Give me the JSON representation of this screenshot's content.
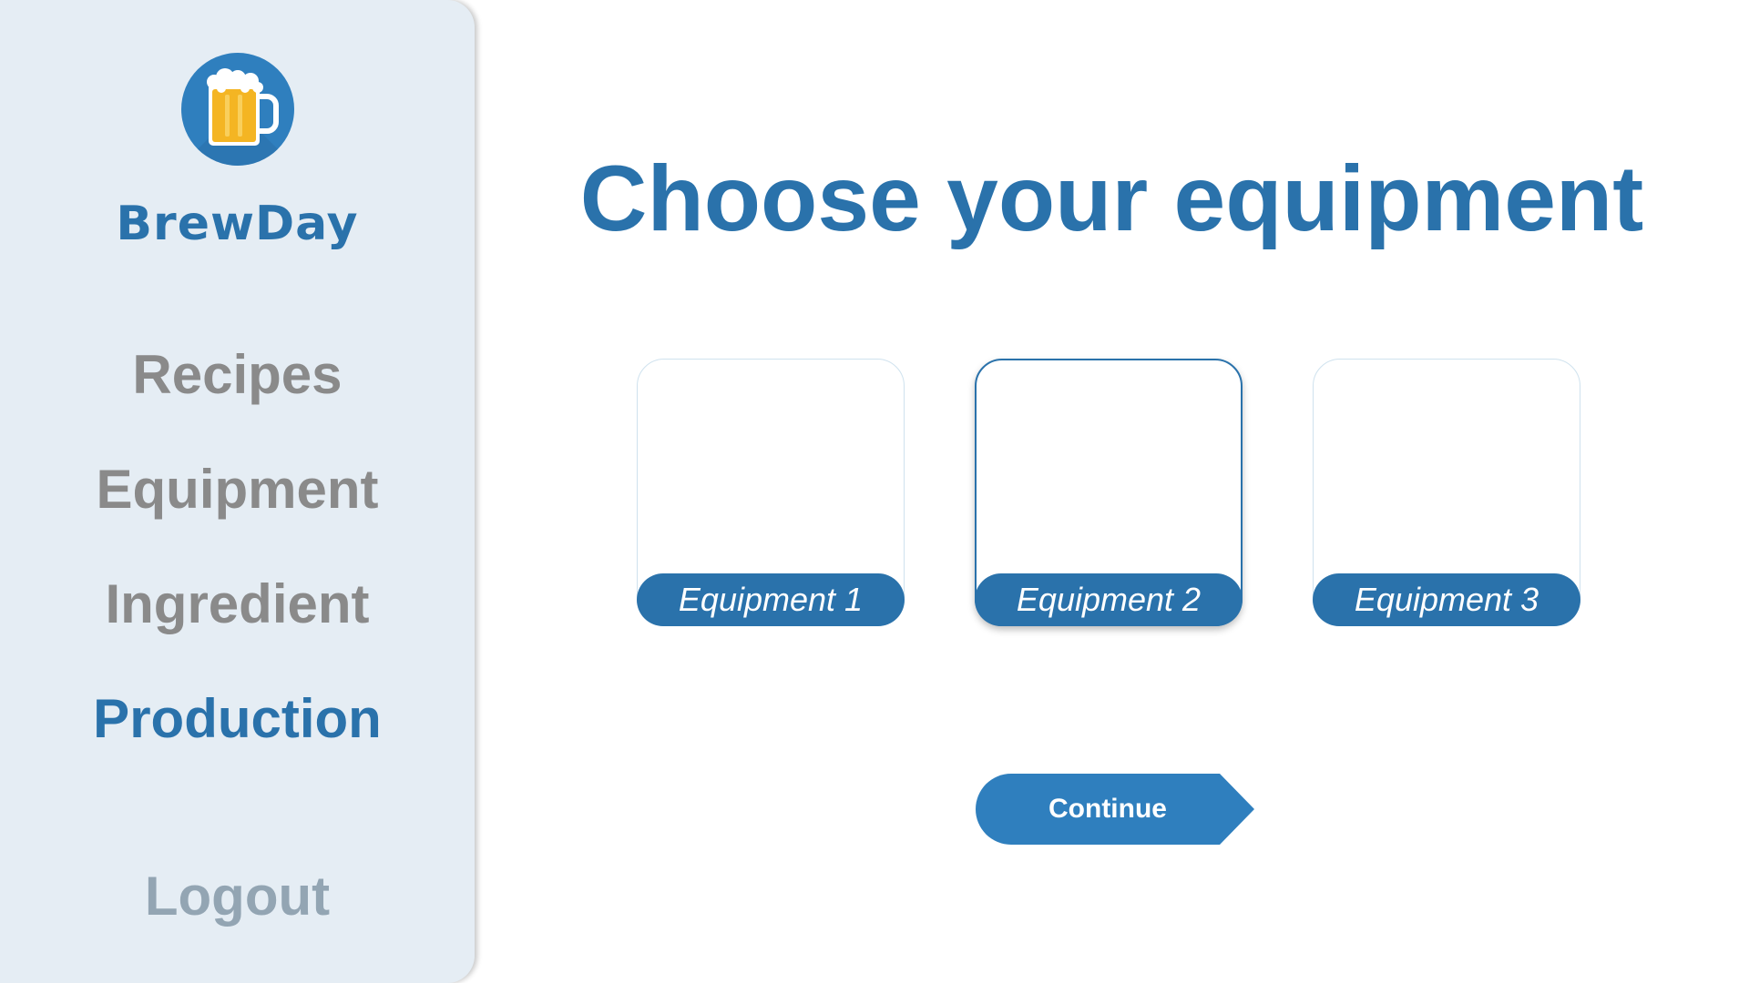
{
  "sidebar": {
    "brand": "BrewDay",
    "logo_icon": "beer-mug-icon",
    "nav": [
      {
        "label": "Recipes",
        "active": false
      },
      {
        "label": "Equipment",
        "active": false
      },
      {
        "label": "Ingredient",
        "active": false
      },
      {
        "label": "Production",
        "active": true
      }
    ],
    "logout_label": "Logout"
  },
  "main": {
    "title": "Choose your equipment",
    "cards": [
      {
        "label": "Equipment 1",
        "selected": false
      },
      {
        "label": "Equipment 2",
        "selected": true
      },
      {
        "label": "Equipment 3",
        "selected": false
      }
    ],
    "continue_label": "Continue"
  },
  "colors": {
    "accent": "#2a72ab",
    "sidebar_bg": "#e5edf4",
    "nav_inactive": "#8a8a8a",
    "logout": "#93a5b3",
    "logo_bg": "#2f7fbe",
    "beer": "#f4b523"
  }
}
